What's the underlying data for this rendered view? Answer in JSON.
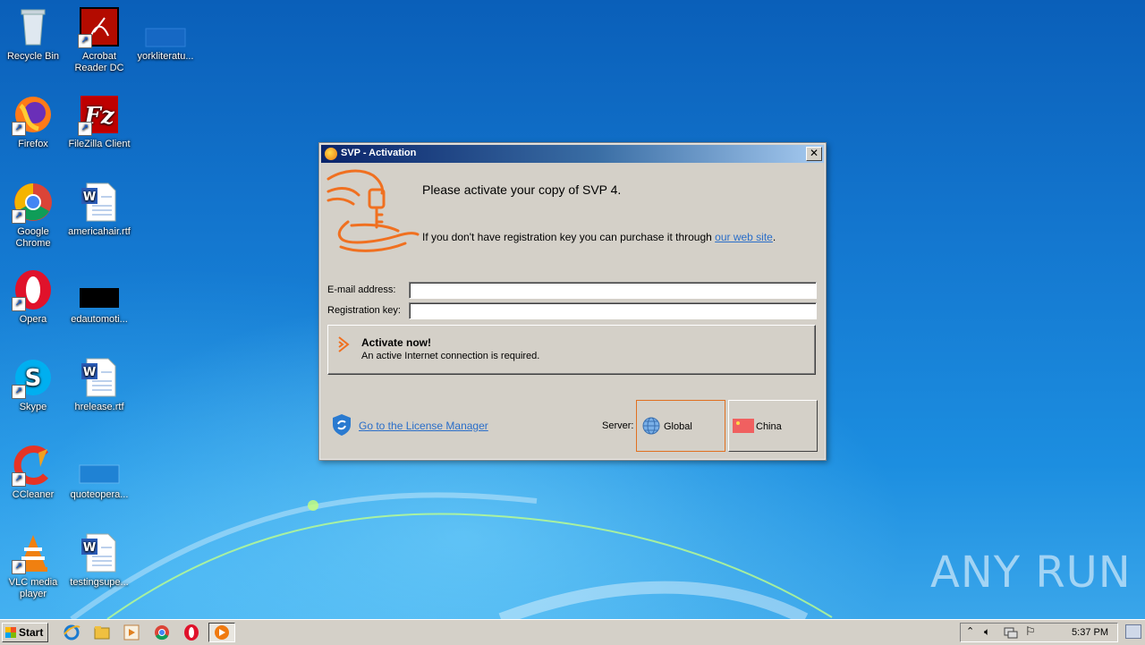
{
  "desktop": {
    "icons": [
      {
        "label": "Recycle Bin",
        "icon": "recycle-bin-icon"
      },
      {
        "label": "Acrobat Reader DC",
        "icon": "acrobat-icon"
      },
      {
        "label": "yorkliteratu...",
        "icon": "file-icon"
      },
      {
        "label": "Firefox",
        "icon": "firefox-icon"
      },
      {
        "label": "FileZilla Client",
        "icon": "filezilla-icon"
      },
      {
        "label": "Google Chrome",
        "icon": "chrome-icon"
      },
      {
        "label": "americahair.rtf",
        "icon": "word-doc-icon"
      },
      {
        "label": "Opera",
        "icon": "opera-icon"
      },
      {
        "label": "edautomoti...",
        "icon": "file-icon"
      },
      {
        "label": "Skype",
        "icon": "skype-icon"
      },
      {
        "label": "hrelease.rtf",
        "icon": "word-doc-icon"
      },
      {
        "label": "CCleaner",
        "icon": "ccleaner-icon"
      },
      {
        "label": "quoteopera...",
        "icon": "file-icon"
      },
      {
        "label": "VLC media player",
        "icon": "vlc-icon"
      },
      {
        "label": "testingsupe...",
        "icon": "word-doc-icon"
      }
    ],
    "watermark": "ANY RUN"
  },
  "dialog": {
    "title": "SVP - Activation",
    "close_label": "✕",
    "heading": "Please activate your copy of SVP 4.",
    "purchase_text": "If you don't have registration key you can purchase it through ",
    "purchase_link": "our web site",
    "purchase_end": ".",
    "email_label": "E-mail address:",
    "email_value": "",
    "key_label": "Registration key:",
    "key_value": "",
    "activate_title": "Activate now!",
    "activate_subtitle": "An active Internet connection is required.",
    "license_manager_link": "Go to the License Manager",
    "server_label": "Server:",
    "servers": [
      {
        "label": "Global",
        "selected": true
      },
      {
        "label": "China",
        "selected": false
      }
    ],
    "accent_color": "#f07020"
  },
  "taskbar": {
    "start_label": "Start",
    "pinned": [
      "internet-explorer-icon",
      "explorer-icon",
      "media-player-icon",
      "chrome-icon",
      "opera-icon",
      "svp-icon"
    ],
    "clock": "5:37 PM"
  }
}
